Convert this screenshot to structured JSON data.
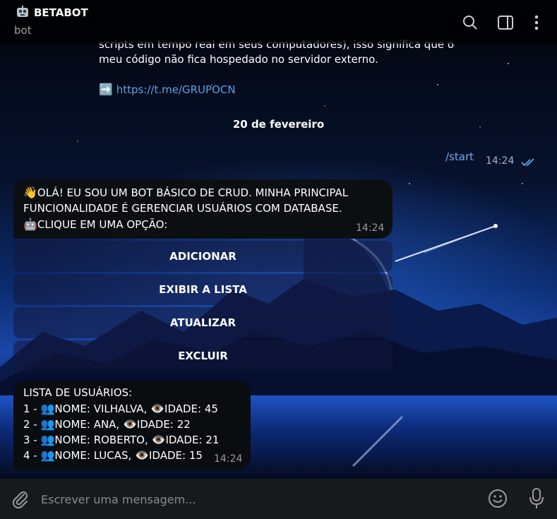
{
  "header": {
    "title": "BETABOT",
    "subtitle": "bot",
    "icons": [
      "robot-icon",
      "search-icon",
      "sidebar-toggle-icon",
      "more-vertical-icon"
    ]
  },
  "prev_message": {
    "line1": "scripts em tempo real em seus computadores), isso significa que o",
    "line2": "meu código não fica hospedado no servidor externo.",
    "link_arrow": "➡️",
    "link": "https://t.me/GRUPOCN"
  },
  "date_separator": "20 de fevereiro",
  "outgoing": {
    "text": "/start",
    "time": "14:24",
    "status": "read"
  },
  "bot_message": {
    "line1_emoji": "👋",
    "line1": "OLÁ! EU SOU UM BOT BÁSICO DE CRUD. MINHA PRINCIPAL",
    "line2": "FUNCIONALIDADE É GERENCIAR USUÁRIOS COM DATABASE.",
    "line3_emoji": "🤖",
    "line3": "CLIQUE EM UMA OPÇÃO:",
    "time": "14:24"
  },
  "keyboard": [
    "ADICIONAR",
    "EXIBIR A LISTA",
    "ATUALIZAR",
    "EXCLUIR"
  ],
  "list_message": {
    "header": "LISTA DE USUÁRIOS:",
    "rows": [
      {
        "prefix": "1 - ",
        "name": "NOME: VILHALVA, ",
        "age": "IDADE: 45"
      },
      {
        "prefix": "2 - ",
        "name": "NOME: ANA, ",
        "age": "IDADE: 22"
      },
      {
        "prefix": "3 - ",
        "name": "NOME: ROBERTO, ",
        "age": "IDADE: 21"
      },
      {
        "prefix": "4 - ",
        "name": "NOME: LUCAS, ",
        "age": "IDADE: 15"
      }
    ],
    "people_emoji": "👥",
    "eye_emoji": "👁️",
    "time": "14:24"
  },
  "composer": {
    "placeholder": "Escrever uma mensagem...",
    "icons": [
      "paperclip-icon",
      "emoji-icon",
      "microphone-icon"
    ]
  },
  "colors": {
    "link": "#5ea0e6",
    "outgoing_text": "#73a9e9",
    "read_check": "#5fa8e8"
  }
}
